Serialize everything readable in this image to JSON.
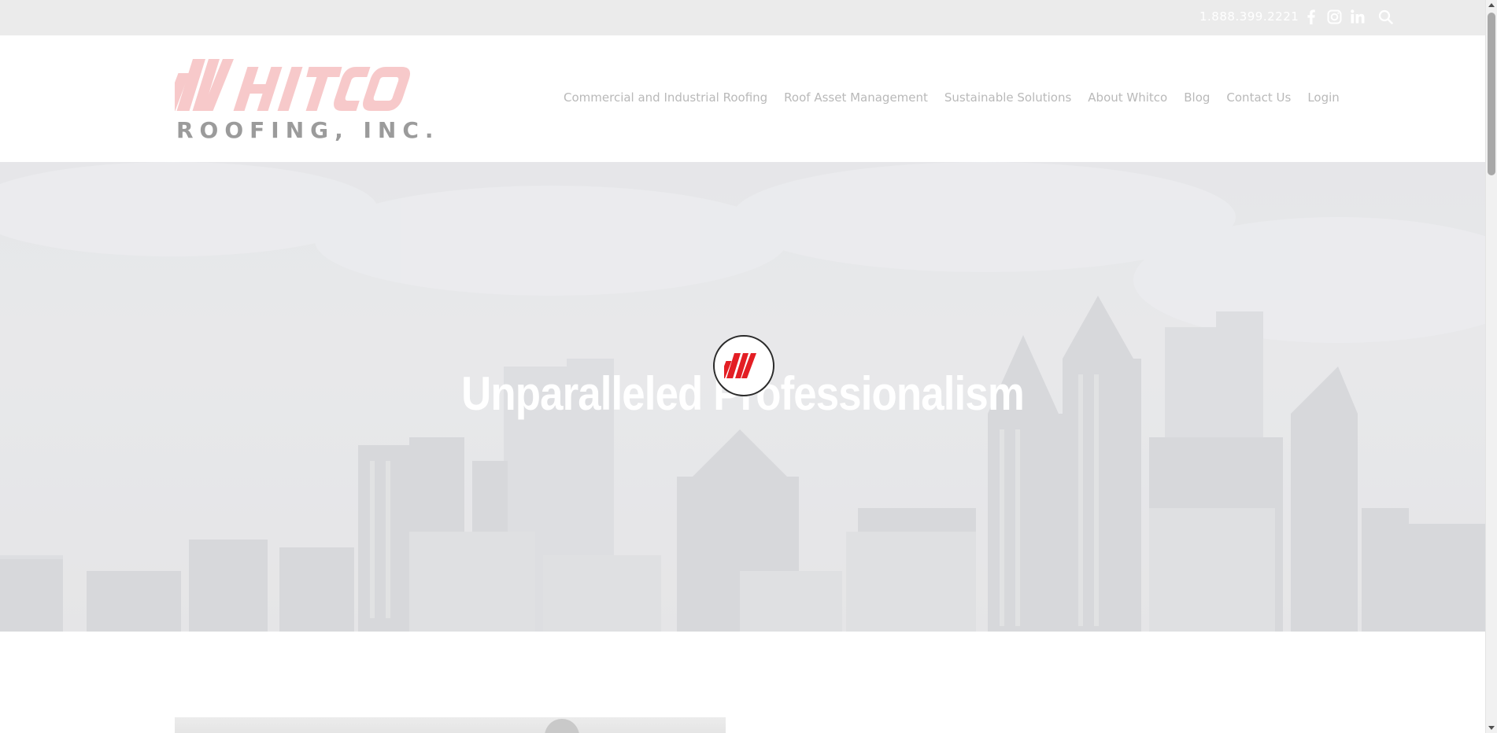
{
  "topbar": {
    "phone": "1.888.399.2221",
    "icons": [
      "facebook-icon",
      "instagram-icon",
      "linkedin-icon",
      "search-icon"
    ]
  },
  "header": {
    "logo": {
      "wordmark": "WHITCO",
      "subtitle": "ROOFING, INC."
    },
    "nav": [
      "Commercial and Industrial Roofing",
      "Roof Asset Management",
      "Sustainable Solutions",
      "About Whitco",
      "Blog",
      "Contact Us",
      "Login"
    ]
  },
  "hero": {
    "title": "Unparalleled Professionalism"
  },
  "loader": {
    "mark": "W"
  },
  "colors": {
    "brand_red": "#e31e24",
    "logo_red_faded": "#f7c9ca",
    "nav_text": "#b9b9b9",
    "topbar_bg": "#ebebeb"
  }
}
